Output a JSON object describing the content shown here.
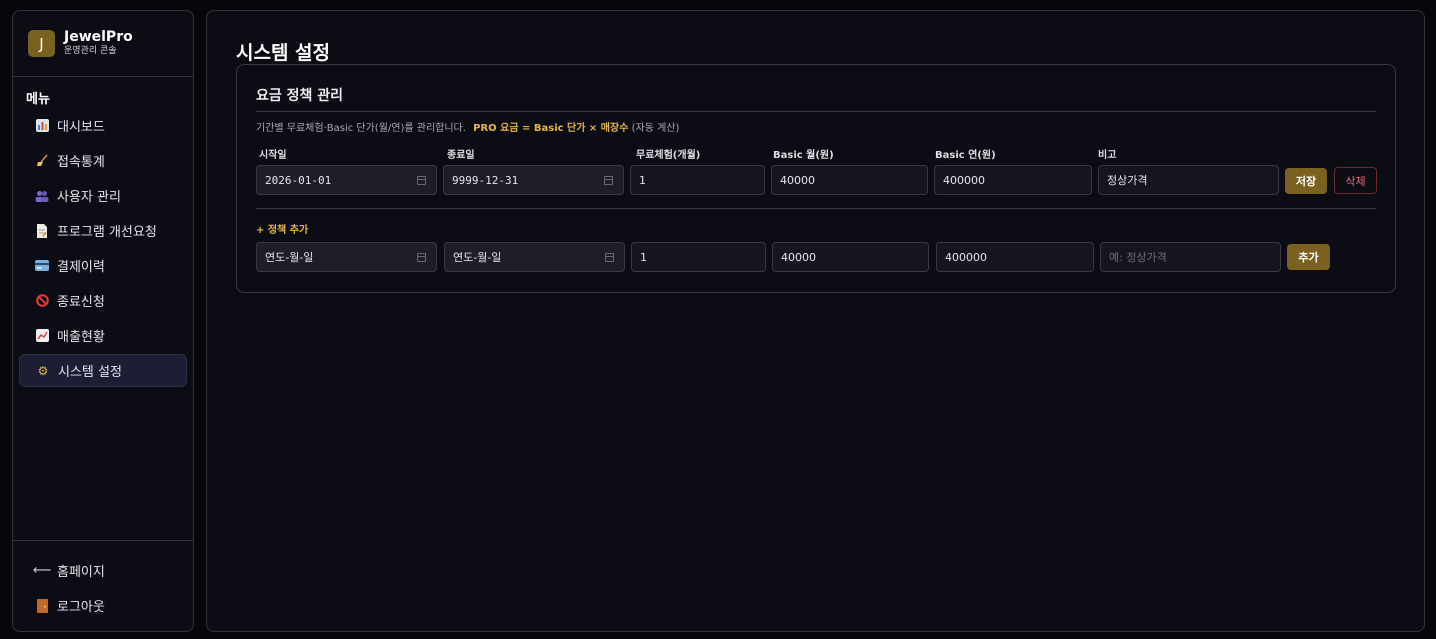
{
  "brand": {
    "logo_letter": "J",
    "name": "JewelPro",
    "subtitle": "운영관리 콘솔"
  },
  "menu_title": "메뉴",
  "nav": [
    {
      "label": "대시보드",
      "icon": "bar-chart-icon"
    },
    {
      "label": "접속통계",
      "icon": "broom-icon"
    },
    {
      "label": "사용자 관리",
      "icon": "users-icon"
    },
    {
      "label": "프로그램 개선요청",
      "icon": "document-icon"
    },
    {
      "label": "결제이력",
      "icon": "credit-card-icon"
    },
    {
      "label": "종료신청",
      "icon": "prohibited-icon"
    },
    {
      "label": "매출현황",
      "icon": "trend-up-icon"
    },
    {
      "label": "시스템 설정",
      "icon": "gear-icon",
      "active": true
    }
  ],
  "bottom_nav": [
    {
      "label": "홈페이지",
      "icon": "arrow-left-icon"
    },
    {
      "label": "로그아웃",
      "icon": "door-icon"
    }
  ],
  "page_title": "시스템 설정",
  "pricing": {
    "title": "요금 정책 관리",
    "description": "기간별 무료체험·Basic 단가(월/연)를 관리합니다.",
    "formula": "PRO 요금 = Basic 단가 × 매장수",
    "formula_note": "(자동 계산)",
    "columns": [
      "시작일",
      "종료일",
      "무료체험(개월)",
      "Basic 월(원)",
      "Basic 연(원)",
      "비고"
    ],
    "rows": [
      {
        "start": "2026-01-01",
        "end": "9999-12-31",
        "trial_months": "1",
        "basic_month": "40000",
        "basic_year": "400000",
        "note": "정상가격"
      }
    ],
    "save_label": "저장",
    "delete_label": "삭제",
    "add_policy_label": "+ 정책 추가",
    "new_row": {
      "start_placeholder": "연도-월-일",
      "end_placeholder": "연도-월-일",
      "trial_months": "1",
      "basic_month": "40000",
      "basic_year": "400000",
      "note_placeholder": "예: 정상가격"
    },
    "add_label": "추가"
  },
  "colors": {
    "accent": "#7b6120",
    "highlight": "#e3b54a",
    "danger": "#e8707a"
  }
}
